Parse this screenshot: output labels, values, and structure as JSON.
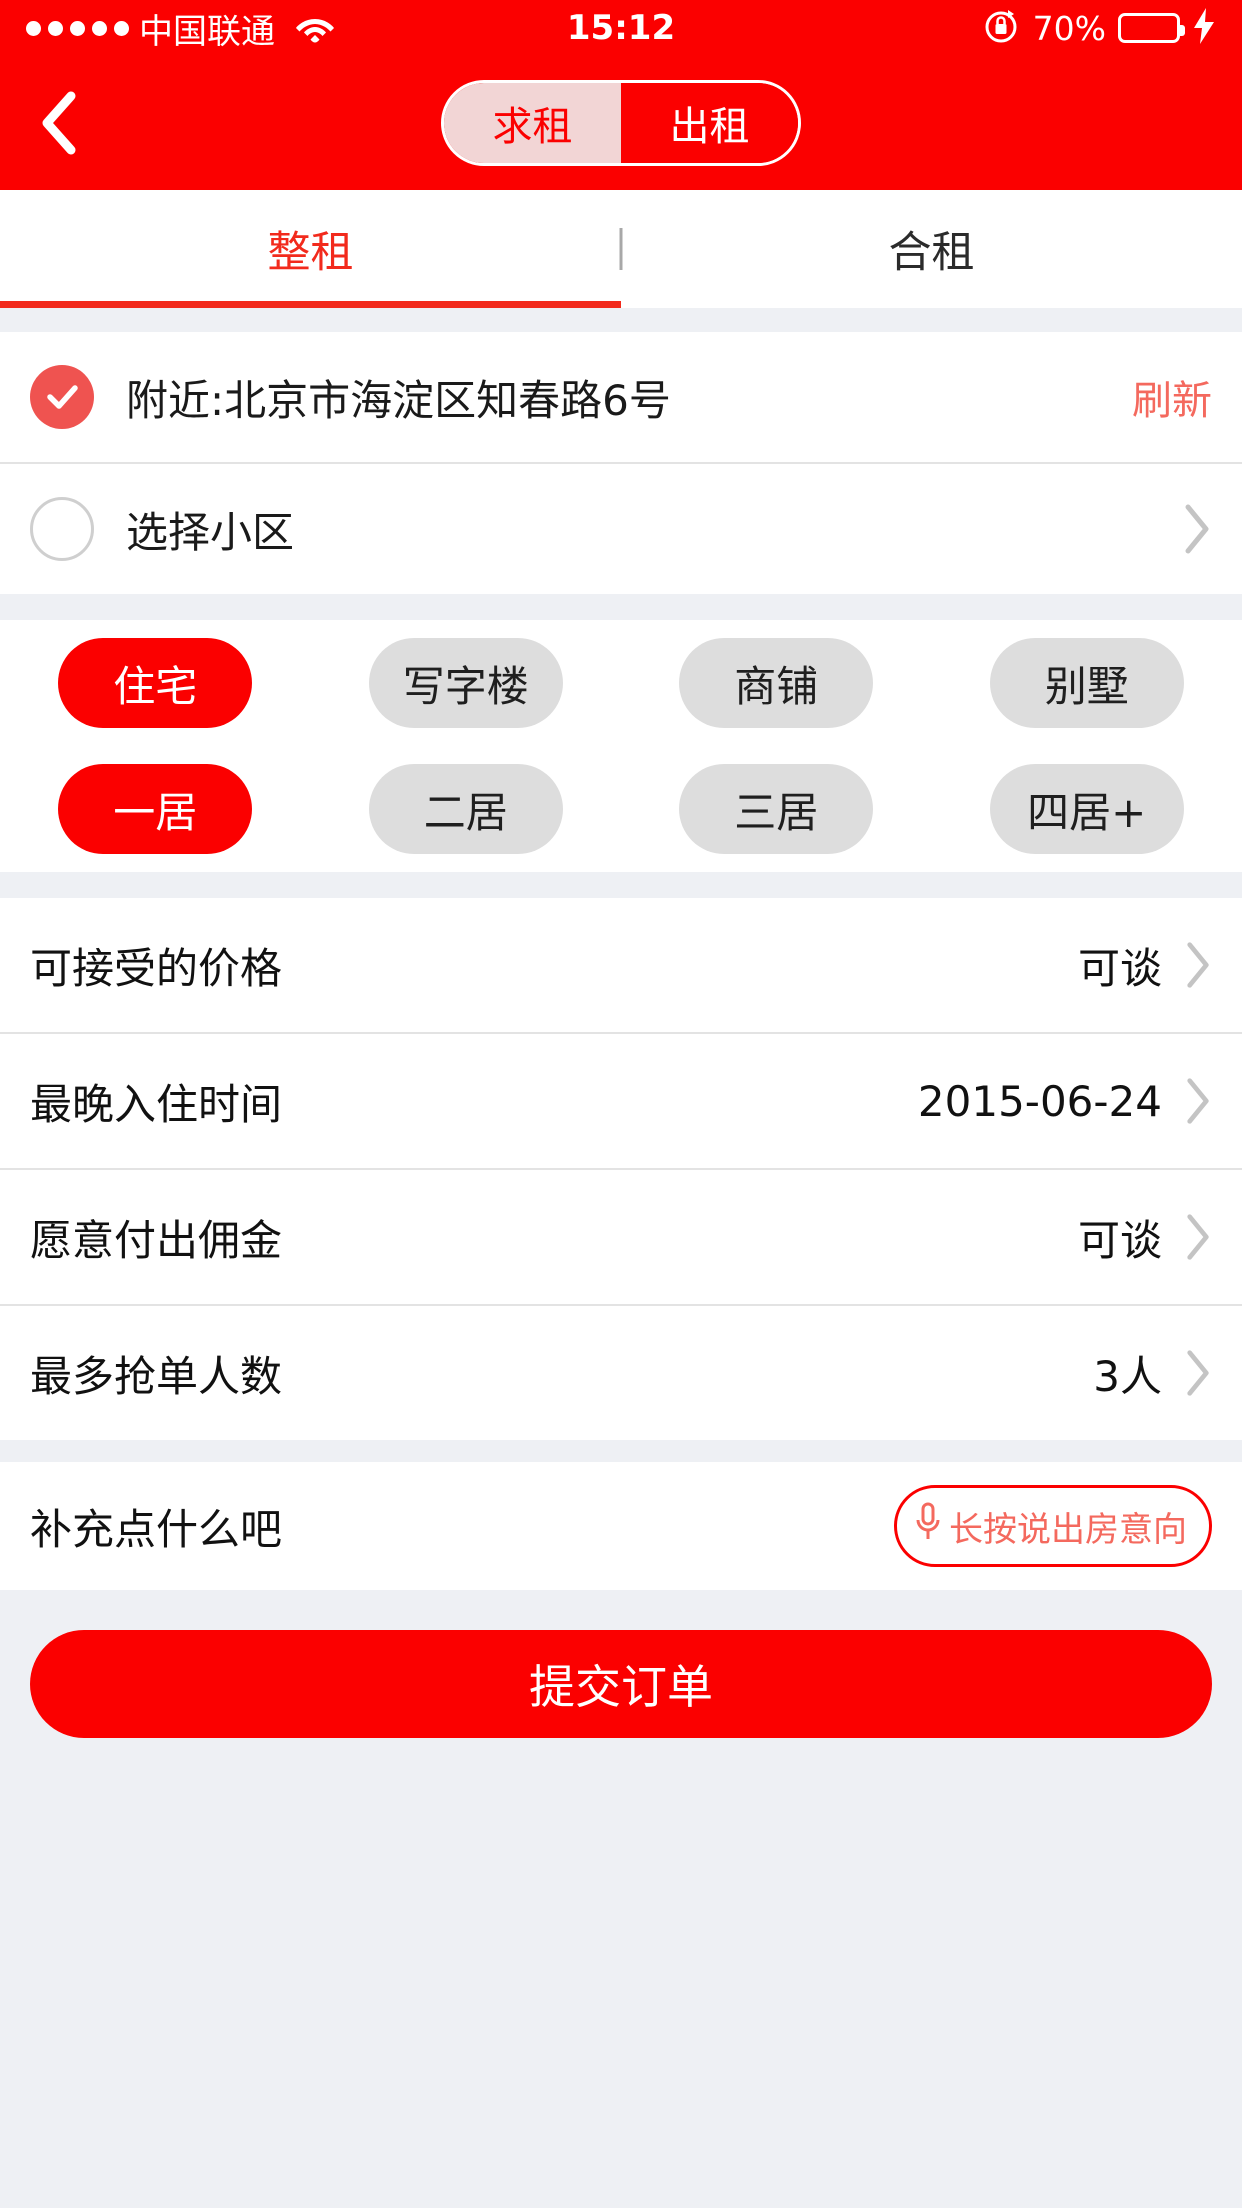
{
  "status_bar": {
    "signal_dots": 5,
    "carrier": "中国联通",
    "wifi_icon": "wifi-icon",
    "time": "15:12",
    "rotation_lock_icon": "rotation-lock-icon",
    "battery_percent": "70%",
    "battery_level": 70,
    "battery_color": "#4ad963",
    "charging_icon": "lightning-bolt-icon"
  },
  "nav": {
    "back_icon": "chevron-left-icon",
    "segments": [
      {
        "label": "求租",
        "selected": true
      },
      {
        "label": "出租",
        "selected": false
      }
    ]
  },
  "tabs": [
    {
      "label": "整租",
      "active": true
    },
    {
      "label": "合租",
      "active": false
    }
  ],
  "location": {
    "nearby": {
      "label": "附近:北京市海淀区知春路6号",
      "selected": true,
      "radio_icon": "check-circle-icon"
    },
    "refresh_label": "刷新",
    "community": {
      "label": "选择小区",
      "selected": false,
      "radio_icon": "empty-circle-icon",
      "chevron_icon": "chevron-right-icon"
    }
  },
  "property_types": [
    {
      "label": "住宅",
      "selected": true
    },
    {
      "label": "写字楼",
      "selected": false
    },
    {
      "label": "商铺",
      "selected": false
    },
    {
      "label": "别墅",
      "selected": false
    }
  ],
  "room_counts": [
    {
      "label": "一居",
      "selected": true
    },
    {
      "label": "二居",
      "selected": false
    },
    {
      "label": "三居",
      "selected": false
    },
    {
      "label": "四居+",
      "selected": false
    }
  ],
  "details": [
    {
      "label": "可接受的价格",
      "value": "可谈",
      "chevron_icon": "chevron-right-icon"
    },
    {
      "label": "最晚入住时间",
      "value": "2015-06-24",
      "chevron_icon": "chevron-right-icon"
    },
    {
      "label": "愿意付出佣金",
      "value": "可谈",
      "chevron_icon": "chevron-right-icon"
    },
    {
      "label": "最多抢单人数",
      "value": "3人",
      "chevron_icon": "chevron-right-icon"
    }
  ],
  "note": {
    "label": "补充点什么吧",
    "mic_icon": "microphone-icon",
    "mic_label": "长按说出房意向"
  },
  "submit": {
    "label": "提交订单"
  },
  "colors": {
    "brand_red": "#fb0000",
    "accent_coral": "#ef5350",
    "tab_red": "#f22a1c",
    "page_bg": "#eef0f4",
    "pill_gray": "#dddddd"
  }
}
